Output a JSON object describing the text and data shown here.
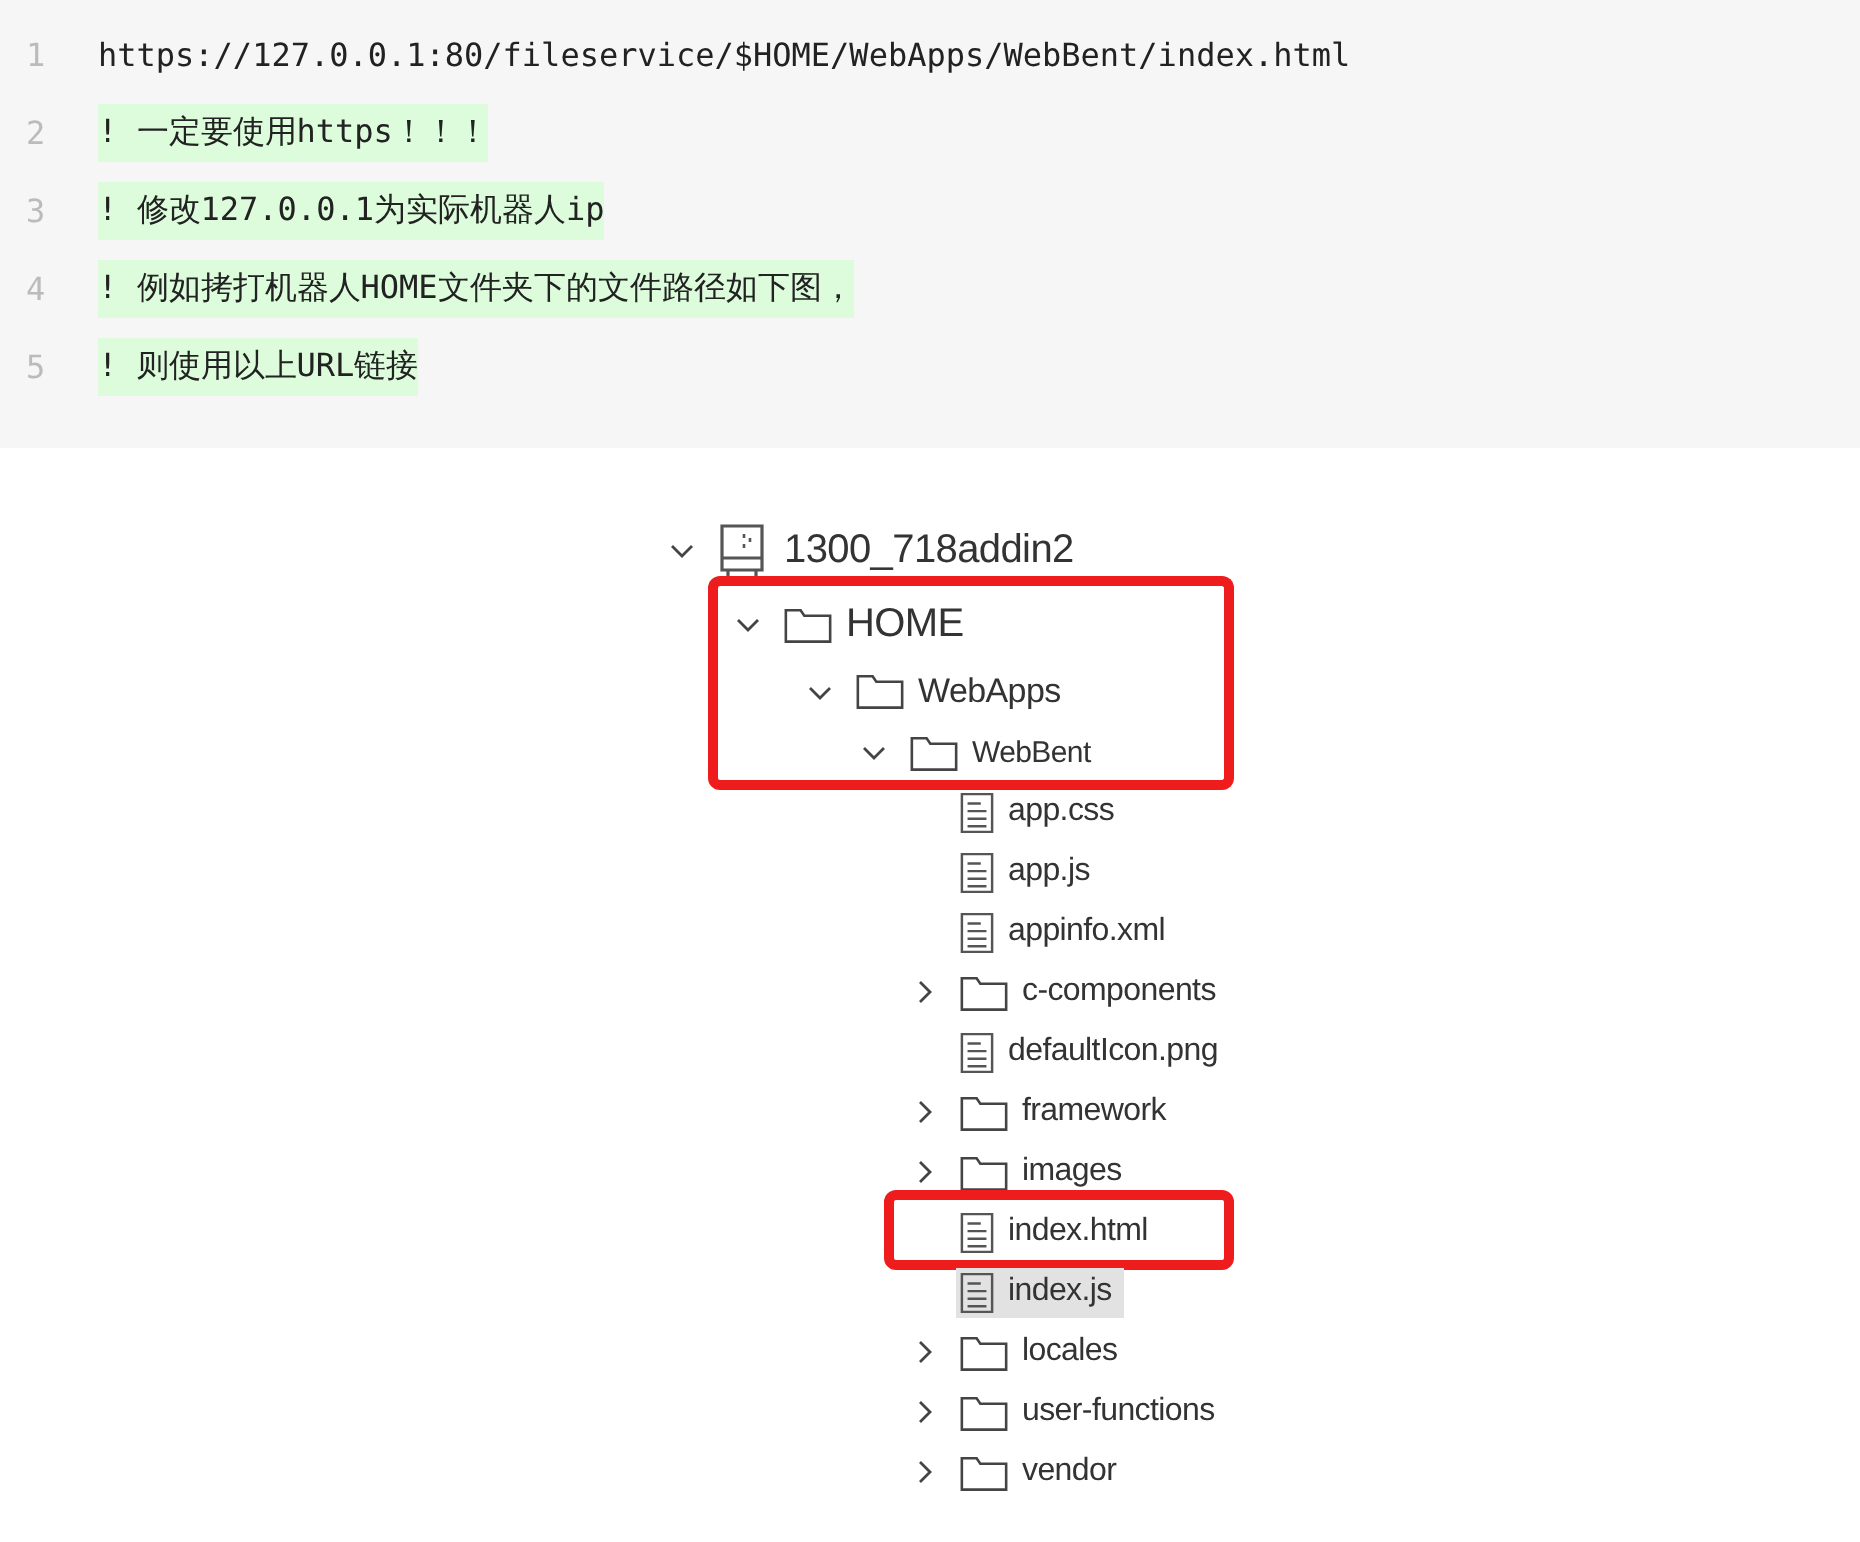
{
  "code_block": {
    "lines": [
      {
        "number": "1",
        "text": "https://127.0.0.1:80/fileservice/$HOME/WebApps/WebBent/index.html",
        "highlighted": false
      },
      {
        "number": "2",
        "text": "! 一定要使用https！！！",
        "highlighted": true
      },
      {
        "number": "3",
        "text": "! 修改127.0.0.1为实际机器人ip",
        "highlighted": true
      },
      {
        "number": "4",
        "text": "! 例如拷打机器人HOME文件夹下的文件路径如下图，",
        "highlighted": true
      },
      {
        "number": "5",
        "text": "! 则使用以上URL链接",
        "highlighted": true
      }
    ]
  },
  "file_tree": {
    "items": [
      {
        "kind": "device",
        "label": "1300_718addin2",
        "expanded": true,
        "selected": false,
        "marked": false,
        "children": [
          {
            "kind": "folder",
            "label": "HOME",
            "expanded": true,
            "selected": false,
            "marked": true,
            "children": [
              {
                "kind": "folder",
                "label": "WebApps",
                "expanded": true,
                "selected": false,
                "marked": true,
                "children": [
                  {
                    "kind": "folder",
                    "label": "WebBent",
                    "expanded": true,
                    "selected": false,
                    "marked": true,
                    "children": [
                      {
                        "kind": "file",
                        "label": "app.css",
                        "selected": false,
                        "marked": false
                      },
                      {
                        "kind": "file",
                        "label": "app.js",
                        "selected": false,
                        "marked": false
                      },
                      {
                        "kind": "file",
                        "label": "appinfo.xml",
                        "selected": false,
                        "marked": false
                      },
                      {
                        "kind": "folder",
                        "label": "c-components",
                        "expanded": false,
                        "selected": false,
                        "marked": false
                      },
                      {
                        "kind": "file",
                        "label": "defaultIcon.png",
                        "selected": false,
                        "marked": false
                      },
                      {
                        "kind": "folder",
                        "label": "framework",
                        "expanded": false,
                        "selected": false,
                        "marked": false
                      },
                      {
                        "kind": "folder",
                        "label": "images",
                        "expanded": false,
                        "selected": false,
                        "marked": false
                      },
                      {
                        "kind": "file",
                        "label": "index.html",
                        "selected": false,
                        "marked": true
                      },
                      {
                        "kind": "file",
                        "label": "index.js",
                        "selected": true,
                        "marked": false
                      },
                      {
                        "kind": "folder",
                        "label": "locales",
                        "expanded": false,
                        "selected": false,
                        "marked": false
                      },
                      {
                        "kind": "folder",
                        "label": "user-functions",
                        "expanded": false,
                        "selected": false,
                        "marked": false
                      },
                      {
                        "kind": "folder",
                        "label": "vendor",
                        "expanded": false,
                        "selected": false,
                        "marked": false
                      }
                    ]
                  }
                ]
              }
            ]
          }
        ]
      }
    ]
  }
}
